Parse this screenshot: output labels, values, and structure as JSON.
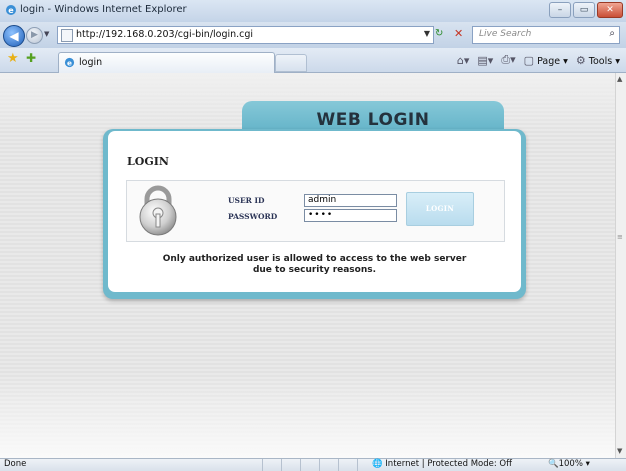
{
  "window": {
    "title": "login - Windows Internet Explorer",
    "minimize": "–",
    "maximize": "▭",
    "close": "✕"
  },
  "address_bar": {
    "url": "http://192.168.0.203/cgi-bin/login.cgi",
    "search_placeholder": "Live Search"
  },
  "tab": {
    "label": "login"
  },
  "toolbar": {
    "page": "Page",
    "tools": "Tools"
  },
  "login_page": {
    "banner": "WEB LOGIN",
    "heading": "LOGIN",
    "user_id_label": "USER ID",
    "password_label": "PASSWORD",
    "user_id_value": "admin",
    "password_value": "••••",
    "login_button": "LOGIN",
    "notice_line1": "Only authorized user is allowed to access to the web server",
    "notice_line2": "due to security reasons."
  },
  "status_bar": {
    "status": "Done",
    "zone": "Internet | Protected Mode: Off",
    "zoom": "100%"
  },
  "colors": {
    "accent_teal": "#6fb9cc",
    "banner_text": "#24323d"
  }
}
